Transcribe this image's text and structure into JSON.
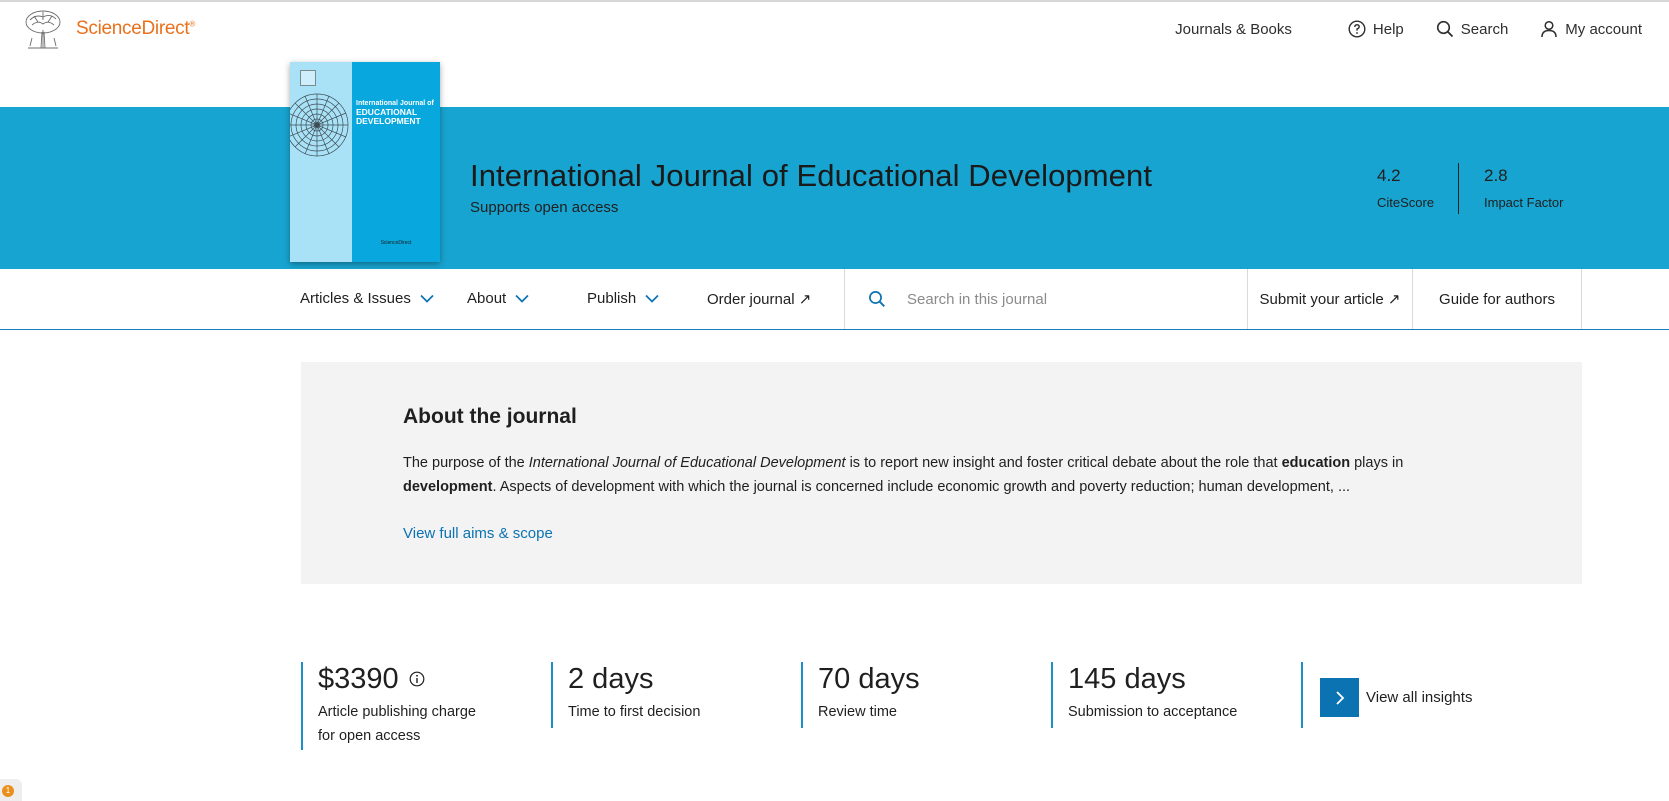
{
  "header": {
    "logo_text": "ScienceDirect",
    "logo_mark": "®",
    "nav": [
      {
        "label": "Journals & Books",
        "icon": ""
      },
      {
        "label": "Help",
        "icon": "help-circle-icon"
      },
      {
        "label": "Search",
        "icon": "search-icon"
      },
      {
        "label": "My account",
        "icon": "user-icon"
      }
    ]
  },
  "journal": {
    "title": "International Journal of Educational Development",
    "subtitle": "Supports open access",
    "cover": {
      "title_line1": "International Journal of",
      "title_line2": "EDUCATIONAL",
      "title_line3": "DEVELOPMENT",
      "publisher": "ScienceDirect"
    },
    "metrics": [
      {
        "value": "4.2",
        "label": "CiteScore"
      },
      {
        "value": "2.8",
        "label": "Impact Factor"
      }
    ]
  },
  "subnav": {
    "tabs": [
      {
        "label": "Articles & Issues",
        "dropdown": true
      },
      {
        "label": "About",
        "dropdown": true
      },
      {
        "label": "Publish",
        "dropdown": true
      },
      {
        "label": "Order journal ↗",
        "dropdown": false
      }
    ],
    "search_placeholder": "Search in this journal",
    "submit_label": "Submit your article ↗",
    "guide_label": "Guide for authors"
  },
  "about": {
    "heading": "About the journal",
    "desc_1": "The purpose of the ",
    "desc_italic": "International Journal of Educational Development",
    "desc_2": " is to report new insight and foster critical debate about the role that ",
    "desc_bold_1": "education",
    "desc_3": " plays in ",
    "desc_bold_2": "development",
    "desc_4": ". Aspects of development with which the journal is concerned include economic growth and poverty reduction; human development, ...",
    "more_link": "View full aims & scope"
  },
  "insights": [
    {
      "value": "$3390",
      "label_line1": "Article publishing charge",
      "label_line2": "for open access"
    },
    {
      "value": "2 days",
      "label_line1": "Time to first decision"
    },
    {
      "value": "70 days",
      "label_line1": "Review time"
    },
    {
      "value": "145 days",
      "label_line1": "Submission to acceptance"
    }
  ],
  "view_all_label": "View all insights",
  "notification_count": "1",
  "colors": {
    "brand_orange": "#e9711c",
    "banner_blue": "#18a4d0",
    "link_blue": "#0c73b2"
  }
}
